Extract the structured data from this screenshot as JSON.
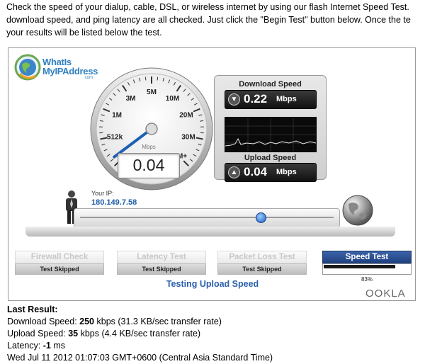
{
  "intro": {
    "line1": "Check the speed of your dialup, cable, DSL, or wireless internet by using our flash Internet Speed Test.",
    "line2": "download speed, and ping latency are all checked. Just click the \"Begin Test\" button below. Once the te",
    "line3": "your results will be listed below the test."
  },
  "logo": {
    "line1": "WhatIs",
    "line2": "MyIPAddress",
    "line3": ".com"
  },
  "gauge": {
    "ticks": [
      "0",
      "512k",
      "1M",
      "3M",
      "5M",
      "10M",
      "20M",
      "30M",
      "50M+"
    ],
    "unit": "Mbps",
    "value": "0.04",
    "needle_tick_fraction": 0.03
  },
  "download": {
    "label": "Download Speed",
    "value": "0.22",
    "unit": "Mbps"
  },
  "upload": {
    "label": "Upload Speed",
    "value": "0.04",
    "unit": "Mbps"
  },
  "your_ip": {
    "label": "Your IP:",
    "value": "180.149.7.58"
  },
  "tabs": [
    {
      "title": "Firewall Check",
      "status": "Test Skipped"
    },
    {
      "title": "Latency Test",
      "status": "Test Skipped"
    },
    {
      "title": "Packet Loss Test",
      "status": "Test Skipped"
    },
    {
      "title": "Speed Test",
      "status": "",
      "progress": 0.83,
      "percent_text": "83%"
    }
  ],
  "status_text": "Testing Upload Speed",
  "brand": "OOKLA",
  "results": {
    "heading": "Last Result:",
    "download_label": "Download Speed: ",
    "download_value": "250",
    "download_rest": " kbps (31.3 KB/sec transfer rate)",
    "upload_label": "Upload Speed: ",
    "upload_value": "35",
    "upload_rest": " kbps (4.4 KB/sec transfer rate)",
    "latency_label": "Latency: ",
    "latency_value": "-1",
    "latency_rest": " ms",
    "timestamp": "Wed Jul 11 2012 01:07:03 GMT+0600 (Central Asia Standard Time)"
  },
  "colors": {
    "accent": "#2c60ad",
    "ip": "#1d5fa6",
    "active_tab": "#1d3f7e"
  }
}
